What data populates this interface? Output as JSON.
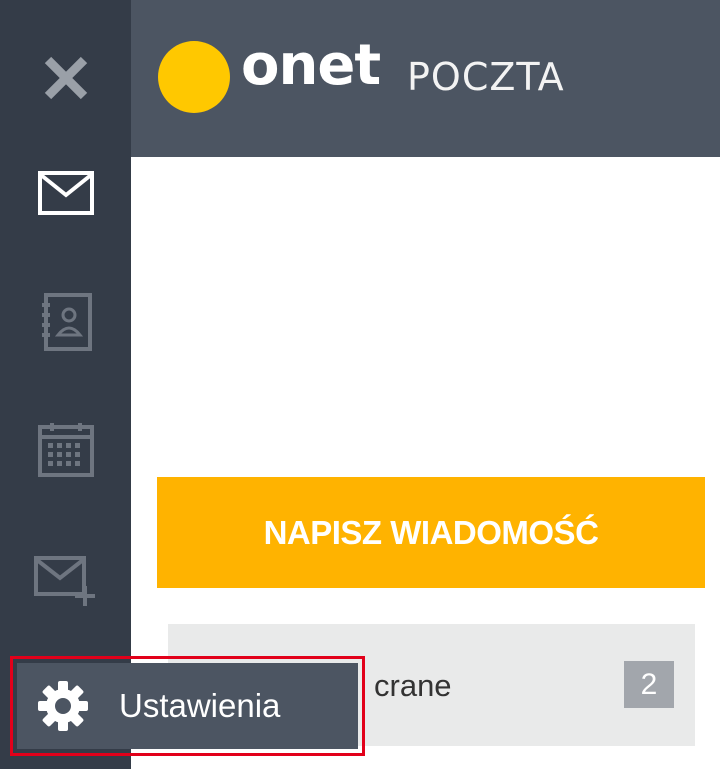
{
  "app": {
    "logo_word": "onet",
    "logo_sub": "POCZTA"
  },
  "sidebar": {
    "items": [
      {
        "icon": "close-icon"
      },
      {
        "icon": "mail-icon",
        "active": true
      },
      {
        "icon": "contacts-icon"
      },
      {
        "icon": "calendar-icon"
      },
      {
        "icon": "mail-add-icon"
      }
    ]
  },
  "main": {
    "compose_label": "NAPISZ WIADOMOŚĆ",
    "folder": {
      "label": "crane",
      "count": "2"
    }
  },
  "popup": {
    "settings_label": "Ustawienia",
    "icon": "gear-icon"
  },
  "colors": {
    "sidebar_bg": "#343c48",
    "header_bg": "#4c5562",
    "brand_yellow": "#ffc800",
    "compose_orange": "#ffb300",
    "highlight_red": "#e2001a"
  }
}
